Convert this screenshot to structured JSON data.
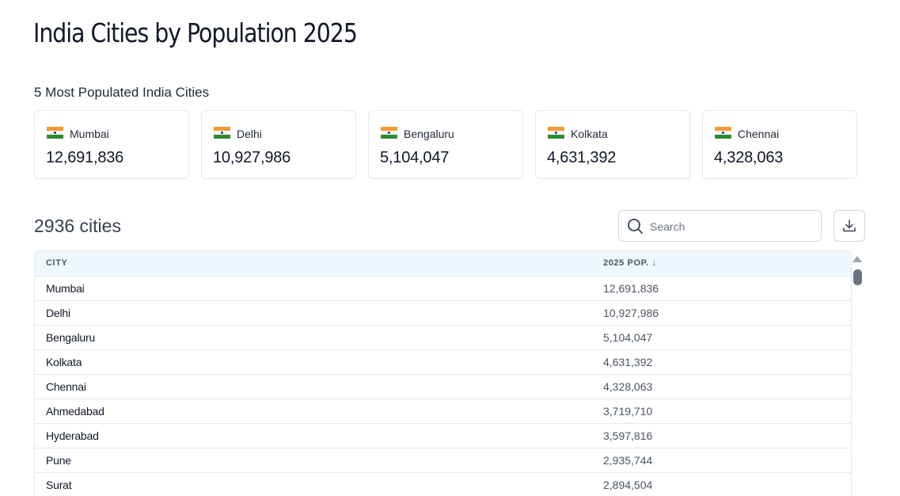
{
  "page": {
    "title": "India Cities by Population 2025"
  },
  "top_cities": {
    "heading": "5 Most Populated India Cities",
    "cards": [
      {
        "name": "Mumbai",
        "population": "12,691,836",
        "flag_icon": "india-flag-icon"
      },
      {
        "name": "Delhi",
        "population": "10,927,986",
        "flag_icon": "india-flag-icon"
      },
      {
        "name": "Bengaluru",
        "population": "5,104,047",
        "flag_icon": "india-flag-icon"
      },
      {
        "name": "Kolkata",
        "population": "4,631,392",
        "flag_icon": "india-flag-icon"
      },
      {
        "name": "Chennai",
        "population": "4,328,063",
        "flag_icon": "india-flag-icon"
      }
    ]
  },
  "table_toolbar": {
    "count_label": "2936 cities",
    "search_placeholder": "Search",
    "search_value": "",
    "search_icon": "search-icon",
    "download_icon": "download-icon"
  },
  "table": {
    "columns": [
      "CITY",
      "2025 POP. ↓"
    ],
    "rows": [
      {
        "city": "Mumbai",
        "population": "12,691,836"
      },
      {
        "city": "Delhi",
        "population": "10,927,986"
      },
      {
        "city": "Bengaluru",
        "population": "5,104,047"
      },
      {
        "city": "Kolkata",
        "population": "4,631,392"
      },
      {
        "city": "Chennai",
        "population": "4,328,063"
      },
      {
        "city": "Ahmedabad",
        "population": "3,719,710"
      },
      {
        "city": "Hyderabad",
        "population": "3,597,816"
      },
      {
        "city": "Pune",
        "population": "2,935,744"
      },
      {
        "city": "Surat",
        "population": "2,894,504"
      }
    ]
  },
  "colors": {
    "header_bg": "#eff6fc",
    "border": "#e5e7eb",
    "flag_saffron": "#f39b32",
    "flag_green": "#2f8a32"
  }
}
